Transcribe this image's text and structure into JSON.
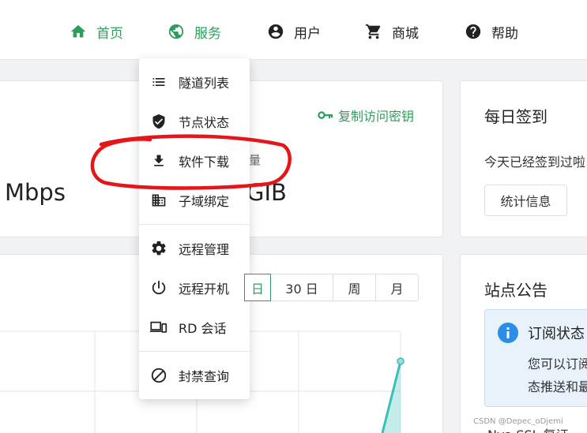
{
  "nav": {
    "home": "首页",
    "service": "服务",
    "user": "用户",
    "shop": "商城",
    "help": "帮助"
  },
  "colors": {
    "accent": "#2e9d5c",
    "annotation": "#e5161a",
    "chart_line": "#3bbfb8",
    "info": "#2a8de6"
  },
  "overview": {
    "copy_key": "复制访问密钥",
    "speed": "Mbps",
    "traffic": "GIB",
    "traffic_label_partial": "量"
  },
  "checkin": {
    "title": "每日签到",
    "text": "今天已经签到过啦",
    "stats_button": "统计信息"
  },
  "range": {
    "day": "日",
    "days30": "30 日",
    "week": "周",
    "month": "月"
  },
  "notice": {
    "title": "站点公告",
    "subtitle": "订阅状态",
    "line1": "您可以订阅",
    "line2": "态推送和最",
    "next": "Nya SSL 复证"
  },
  "dropdown": {
    "items": [
      {
        "label": "隧道列表",
        "icon": "list-icon"
      },
      {
        "label": "节点状态",
        "icon": "shield-icon"
      },
      {
        "label": "软件下载",
        "icon": "download-icon"
      },
      {
        "label": "子域绑定",
        "icon": "domain-icon"
      },
      {
        "label": "远程管理",
        "icon": "gear-icon"
      },
      {
        "label": "远程开机",
        "icon": "power-icon"
      },
      {
        "label": "RD 会话",
        "icon": "rdp-icon"
      },
      {
        "label": "封禁查询",
        "icon": "block-icon"
      }
    ]
  },
  "watermark": "CSDN @Depec_oDjemi"
}
